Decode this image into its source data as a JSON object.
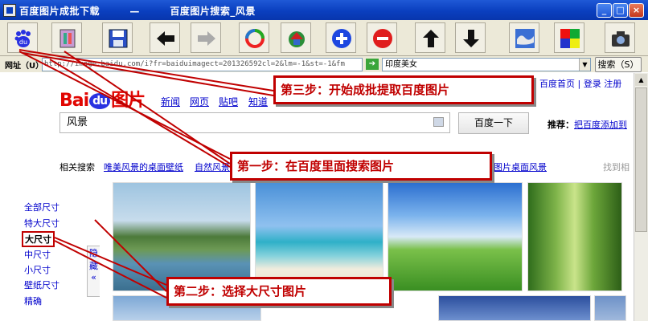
{
  "window": {
    "title": "百度图片成批下载        —        百度图片搜索_风景",
    "min": "_",
    "max": "□",
    "close": "×"
  },
  "toolbar": {
    "buttons": [
      {
        "name": "baidu-paw-icon"
      },
      {
        "name": "batch-download-icon"
      },
      {
        "name": "save-disk-icon"
      },
      {
        "name": "back-arrow-icon"
      },
      {
        "name": "forward-arrow-icon"
      },
      {
        "name": "refresh-icon"
      },
      {
        "name": "home-icon"
      },
      {
        "name": "zoom-in-icon"
      },
      {
        "name": "zoom-out-icon"
      },
      {
        "name": "arrow-up-icon"
      },
      {
        "name": "arrow-down-icon"
      },
      {
        "name": "map-icon"
      },
      {
        "name": "color-grid-icon"
      },
      {
        "name": "camera-icon"
      }
    ]
  },
  "address": {
    "label": "网址（U）",
    "url": "http://image.baidu.com/i?fr=baiduimagect=201326592cl=2&lm=-1&st=-1&fm",
    "search_query": "印度美女",
    "search_button": "搜索（S）"
  },
  "page": {
    "logo_left": "Bai",
    "logo_du": "du",
    "logo_right": "图片",
    "nav": [
      "新闻",
      "网页",
      "贴吧",
      "知道"
    ],
    "user_links": "百度首页 | 登录 注册",
    "query": "风景",
    "search_button": "百度一下",
    "recommend_label": "推荐：",
    "recommend_link": "把百度添加到",
    "related_label": "相关搜索",
    "related": [
      "唯美风景的桌面壁纸",
      "自然风景",
      "图片桌面风景"
    ],
    "find_text": "找到相",
    "sizes": [
      "全部尺寸",
      "特大尺寸",
      "大尺寸",
      "中尺寸",
      "小尺寸",
      "壁纸尺寸",
      "精确"
    ],
    "hide_panel": "隐藏 «"
  },
  "annotations": {
    "step1": "第一步：在百度里面搜索图片",
    "step2": "第二步：选择大尺寸图片",
    "step3": "第三步：开始成批提取百度图片"
  },
  "colors": {
    "callout": "#c00000",
    "link": "#0000cc",
    "titlebar": "#0a3fbf"
  }
}
